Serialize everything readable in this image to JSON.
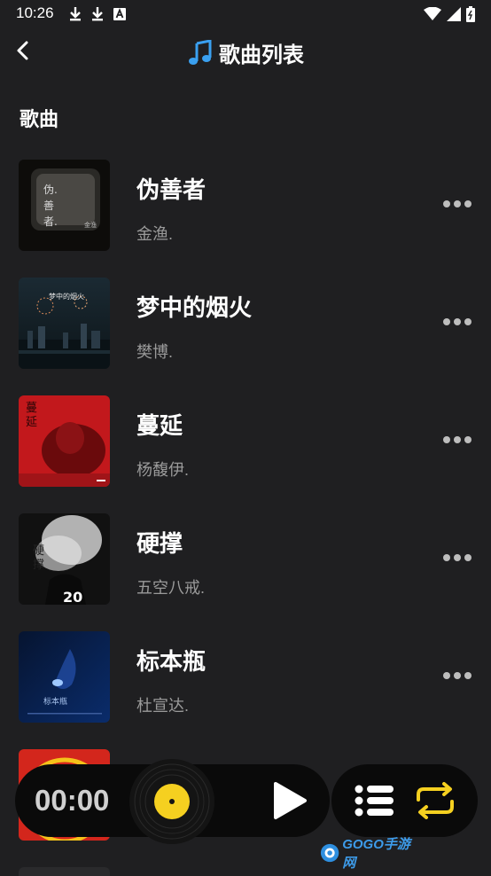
{
  "status_bar": {
    "time": "10:26"
  },
  "header": {
    "title": "歌曲列表"
  },
  "section_title": "歌曲",
  "songs": [
    {
      "title": "伪善者",
      "artist": "金渔."
    },
    {
      "title": "梦中的烟火",
      "artist": "樊博."
    },
    {
      "title": "蔓延",
      "artist": "杨馥伊."
    },
    {
      "title": "硬撑",
      "artist": "五空八戒."
    },
    {
      "title": "标本瓶",
      "artist": "杜宣达."
    },
    {
      "title": "",
      "artist": ""
    }
  ],
  "player": {
    "time": "00:00"
  },
  "watermark": {
    "text": "GOGO手游网"
  },
  "colors": {
    "background": "#1f1f21",
    "player_bg": "#0a0a0a",
    "accent_yellow": "#f5d020",
    "title_icon_blue": "#3aa0f0"
  }
}
